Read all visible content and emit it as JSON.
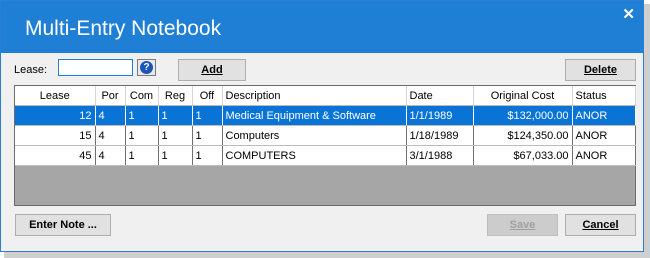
{
  "window": {
    "title": "Multi-Entry Notebook",
    "close_glyph": "✕"
  },
  "toolbar": {
    "lease_label": "Lease:",
    "lease_value": "",
    "help_glyph": "?",
    "add_label": "Add",
    "delete_label": "Delete"
  },
  "grid": {
    "columns": [
      "Lease",
      "Por",
      "Com",
      "Reg",
      "Off",
      "Description",
      "Date",
      "Original Cost",
      "Status"
    ],
    "rows": [
      [
        "12",
        "4",
        "1",
        "1",
        "1",
        "Medical Equipment & Software",
        "1/1/1989",
        "$132,000.00",
        "ANOR"
      ],
      [
        "15",
        "4",
        "1",
        "1",
        "1",
        "Computers",
        "1/18/1989",
        "$124,350.00",
        "ANOR"
      ],
      [
        "45",
        "4",
        "1",
        "1",
        "1",
        "COMPUTERS",
        "3/1/1988",
        "$67,033.00",
        "ANOR"
      ]
    ],
    "selected_row": 0
  },
  "footer": {
    "enter_note_label": "Enter Note ...",
    "save_label": "Save",
    "cancel_label": "Cancel"
  },
  "colors": {
    "titlebar": "#1e7fd4",
    "selection": "#0a73d6"
  }
}
